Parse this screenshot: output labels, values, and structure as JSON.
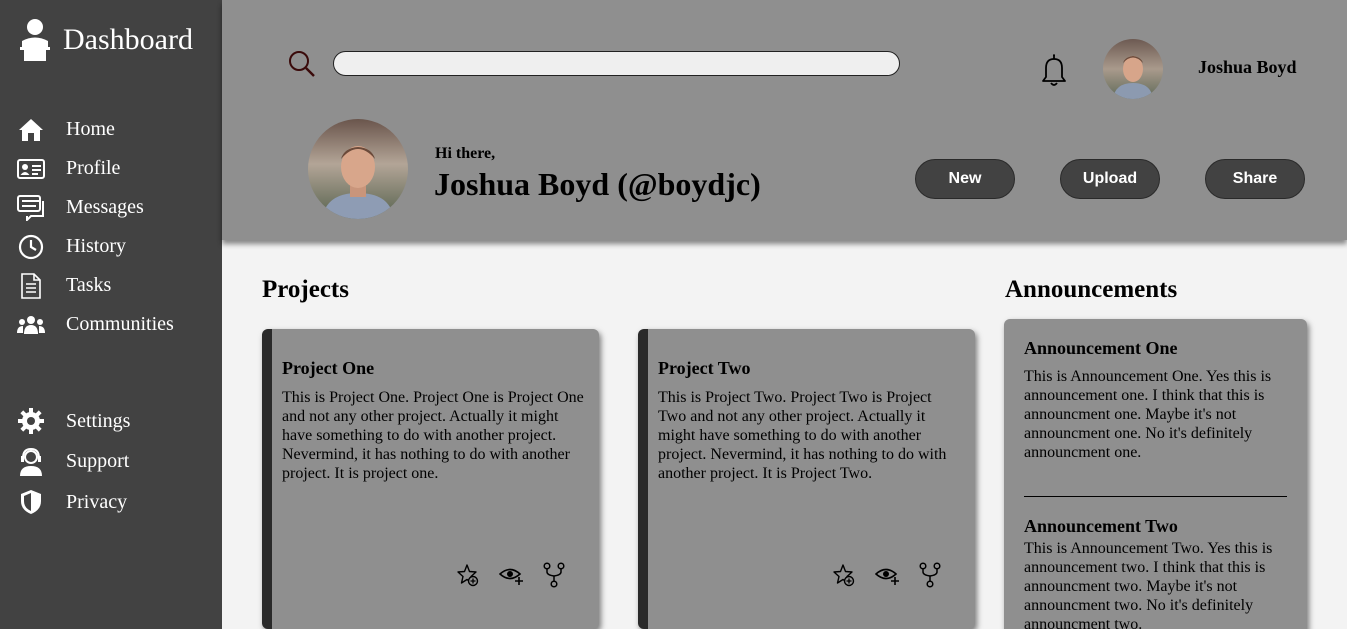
{
  "sidebar": {
    "brand": "Dashboard",
    "items": [
      {
        "label": "Home",
        "icon": "home-icon"
      },
      {
        "label": "Profile",
        "icon": "id-card-icon"
      },
      {
        "label": "Messages",
        "icon": "messages-icon"
      },
      {
        "label": "History",
        "icon": "clock-icon"
      },
      {
        "label": "Tasks",
        "icon": "document-icon"
      },
      {
        "label": "Communities",
        "icon": "users-icon"
      }
    ],
    "bottom_items": [
      {
        "label": "Settings",
        "icon": "gear-icon"
      },
      {
        "label": "Support",
        "icon": "support-agent-icon"
      },
      {
        "label": "Privacy",
        "icon": "shield-icon"
      }
    ]
  },
  "header": {
    "search_value": "",
    "username": "Joshua Boyd",
    "greeting": "Hi there,",
    "fullname": "Joshua Boyd (@boydjc)",
    "buttons": {
      "new": "New",
      "upload": "Upload",
      "share": "Share"
    }
  },
  "projects": {
    "title": "Projects",
    "cards": [
      {
        "title": "Project One",
        "text": "This is Project One. Project One is Project One and not any other project. Actually it might have something to do with another project. Nevermind, it has nothing to do with another project. It is project one."
      },
      {
        "title": "Project Two",
        "text": "This is Project Two. Project Two is Project Two and not any other project. Actually it might have something to do with another project. Nevermind, it has nothing to do with another project. It is Project Two."
      }
    ]
  },
  "announcements": {
    "title": "Announcements",
    "items": [
      {
        "title": "Announcement One",
        "text": "This is Announcement One. Yes this is announcement one. I think that this is announcment one. Maybe it's not announcment one. No it's definitely announcment one."
      },
      {
        "title": "Announcement Two",
        "text": "This is Announcement Two. Yes this is announcement two. I think that this is announcment two. Maybe it's not announcment two. No it's definitely announcment two."
      }
    ]
  },
  "colors": {
    "sidebar_bg": "#424242",
    "header_bg": "#8f8f8f",
    "card_bg": "#8f8f8f",
    "page_bg": "#f3f3f3",
    "button_bg": "#424242"
  }
}
